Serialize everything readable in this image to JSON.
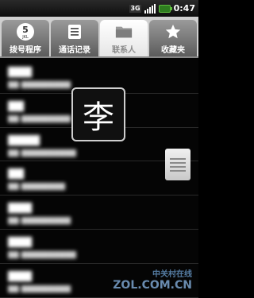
{
  "status_bar": {
    "network": "3G",
    "time": "0:47"
  },
  "tabs": [
    {
      "label": "拨号程序",
      "dial_digit": "5",
      "dial_letters": "JKL",
      "icon": "dialpad-icon"
    },
    {
      "label": "通话记录",
      "icon": "call-log-icon"
    },
    {
      "label": "联系人",
      "icon": "contacts-folder-icon",
      "active": true
    },
    {
      "label": "收藏夹",
      "icon": "star-icon"
    }
  ],
  "contacts": [
    {
      "name": "▇▇▇",
      "sub": "▇▇ ▇▇▇▇▇▇▇▇▇"
    },
    {
      "name": "▇▇",
      "sub": "▇▇ ▇▇▇▇▇▇▇▇▇"
    },
    {
      "name": "▇▇▇▇",
      "sub": "▇▇ ▇▇▇▇▇▇▇▇▇▇"
    },
    {
      "name": "▇▇",
      "sub": "▇▇ ▇▇▇▇▇▇▇▇"
    },
    {
      "name": "▇▇▇",
      "sub": "▇▇ ▇▇▇▇▇▇▇▇▇"
    },
    {
      "name": "▇▇▇",
      "sub": "▇▇ ▇▇▇▇▇▇▇▇▇▇"
    },
    {
      "name": "▇▇▇",
      "sub": "▇▇ ▇▇▇▇▇▇▇▇▇"
    }
  ],
  "index_popup": {
    "letter": "李"
  },
  "watermark": {
    "cn": "中关村在线",
    "url": "ZOL.COM.CN"
  }
}
